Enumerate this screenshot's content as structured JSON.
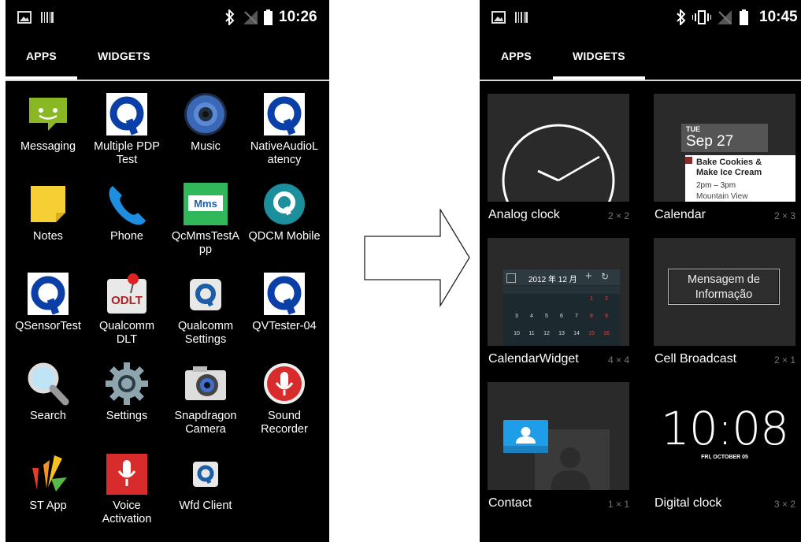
{
  "left_screen": {
    "status": {
      "time": "10:26"
    },
    "tabs": {
      "apps": "APPS",
      "widgets": "WIDGETS",
      "active": "APPS"
    },
    "apps": [
      {
        "label": "Messaging",
        "icon": "messaging-icon"
      },
      {
        "label": "Multiple PDP\nTest",
        "icon": "qualcomm-q-icon"
      },
      {
        "label": "Music",
        "icon": "music-speaker-icon"
      },
      {
        "label": "NativeAudioL\natency",
        "icon": "qualcomm-q-icon"
      },
      {
        "label": "Notes",
        "icon": "notes-icon"
      },
      {
        "label": "Phone",
        "icon": "phone-icon"
      },
      {
        "label": "QcMmsTestA\npp",
        "icon": "mms-icon"
      },
      {
        "label": "QDCM Mobile",
        "icon": "qdcm-icon"
      },
      {
        "label": "QSensorTest",
        "icon": "qualcomm-q-icon"
      },
      {
        "label": "Qualcomm\nDLT",
        "icon": "odlt-icon"
      },
      {
        "label": "Qualcomm\nSettings",
        "icon": "qualcomm-settings-icon"
      },
      {
        "label": "QVTester-04",
        "icon": "qualcomm-q-icon"
      },
      {
        "label": "Search",
        "icon": "search-icon"
      },
      {
        "label": "Settings",
        "icon": "settings-gear-icon"
      },
      {
        "label": "Snapdragon\nCamera",
        "icon": "camera-icon"
      },
      {
        "label": "Sound\nRecorder",
        "icon": "sound-recorder-icon"
      },
      {
        "label": "ST App",
        "icon": "st-app-icon"
      },
      {
        "label": "Voice\nActivation",
        "icon": "voice-activation-icon"
      },
      {
        "label": "Wfd Client",
        "icon": "wfd-client-icon"
      }
    ]
  },
  "right_screen": {
    "status": {
      "time": "10:45"
    },
    "tabs": {
      "apps": "APPS",
      "widgets": "WIDGETS",
      "active": "WIDGETS"
    },
    "widgets": [
      {
        "name": "Analog clock",
        "size": "2 × 2"
      },
      {
        "name": "Calendar",
        "size": "2 × 3",
        "preview": {
          "day": "TUE",
          "date": "Sep 27",
          "event_line1": "Bake Cookies &",
          "event_line2": "Make Ice Cream",
          "time": "2pm – 3pm",
          "place": "Mountain View"
        }
      },
      {
        "name": "CalendarWidget",
        "size": "4 × 4",
        "preview": {
          "header": "2012 年 12 月",
          "rows": [
            [
              "",
              "",
              "",
              "",
              "",
              "1",
              "2"
            ],
            [
              "3",
              "4",
              "5",
              "6",
              "7",
              "8",
              "9"
            ],
            [
              "10",
              "11",
              "12",
              "13",
              "14",
              "15",
              "16"
            ]
          ]
        }
      },
      {
        "name": "Cell Broadcast",
        "size": "2 × 1",
        "preview": {
          "line1": "Mensagem de",
          "line2": "Informação"
        }
      },
      {
        "name": "Contact",
        "size": "1 × 1"
      },
      {
        "name": "Digital clock",
        "size": "3 × 2",
        "preview": {
          "time": "10:08",
          "date": "FRI, OCTOBER 05"
        }
      }
    ]
  },
  "colors": {
    "qualcomm_blue": "#0b3fa8",
    "messaging_green": "#8ab825",
    "notes_yellow": "#f6cf35",
    "record_red": "#d82b2b"
  }
}
